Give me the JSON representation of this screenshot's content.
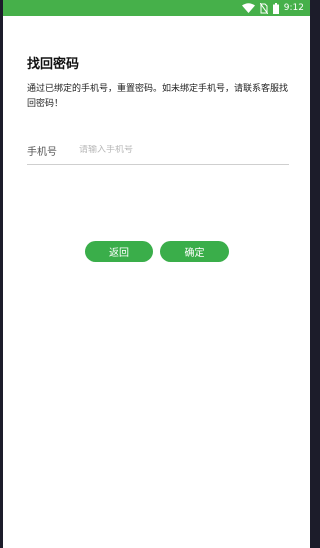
{
  "status_bar": {
    "time": "9:12",
    "icons": [
      "wifi-icon",
      "no-sim-icon",
      "battery-icon"
    ],
    "background": "#46b04a"
  },
  "page": {
    "title": "找回密码",
    "description": "通过已绑定的手机号，重置密码。如未绑定手机号，请联系客服找回密码！"
  },
  "form": {
    "phone_label": "手机号",
    "phone_placeholder": "请输入手机号",
    "phone_value": ""
  },
  "buttons": {
    "back_label": "返回",
    "confirm_label": "确定",
    "color": "#3aae4a"
  }
}
